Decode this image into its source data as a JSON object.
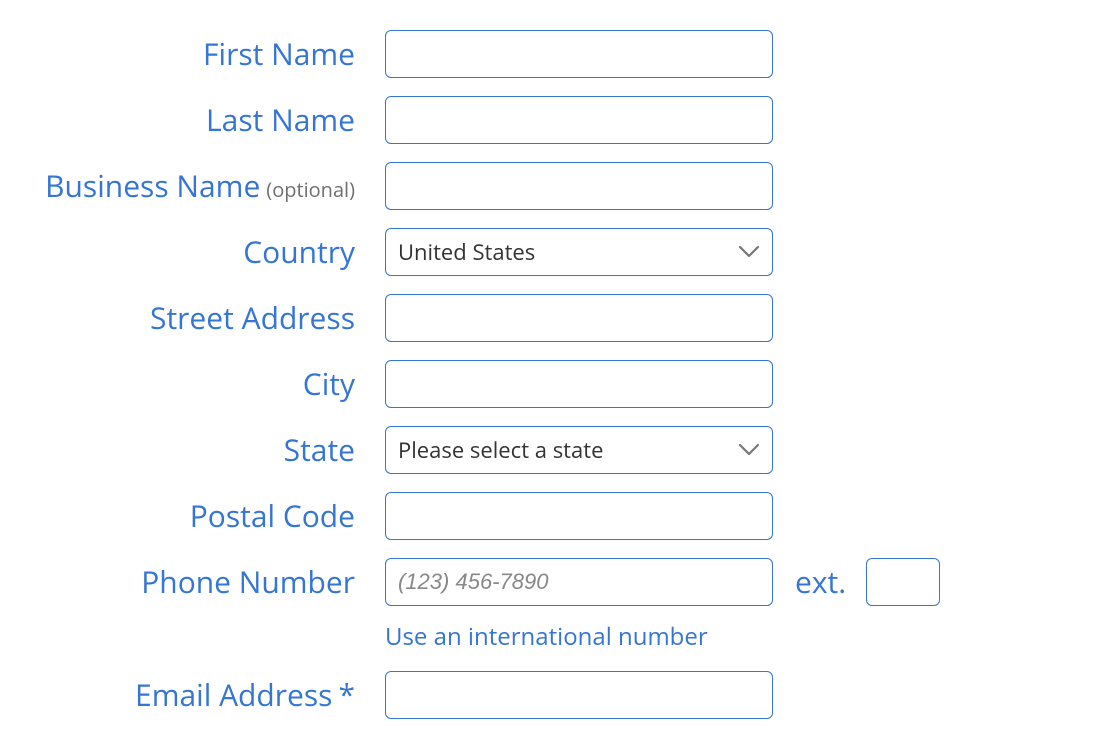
{
  "form": {
    "first_name": {
      "label": "First Name",
      "value": ""
    },
    "last_name": {
      "label": "Last Name",
      "value": ""
    },
    "business_name": {
      "label": "Business Name",
      "hint": "(optional)",
      "value": ""
    },
    "country": {
      "label": "Country",
      "value": "United States"
    },
    "street_address": {
      "label": "Street Address",
      "value": ""
    },
    "city": {
      "label": "City",
      "value": ""
    },
    "state": {
      "label": "State",
      "value": "Please select a state"
    },
    "postal_code": {
      "label": "Postal Code",
      "value": ""
    },
    "phone": {
      "label": "Phone Number",
      "placeholder": "(123) 456-7890",
      "value": "",
      "ext_label": "ext.",
      "ext_value": "",
      "intl_link": "Use an international number"
    },
    "email": {
      "label": "Email Address",
      "required_mark": "*",
      "value": ""
    }
  }
}
